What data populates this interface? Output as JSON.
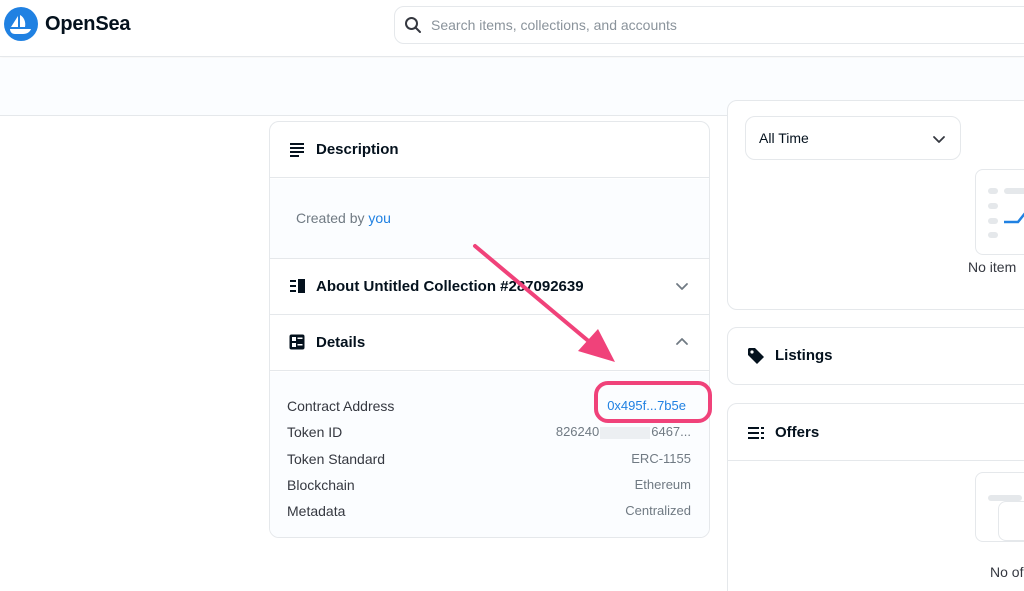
{
  "header": {
    "brand": "OpenSea",
    "search_placeholder": "Search items, collections, and accounts"
  },
  "description": {
    "title": "Description",
    "created_by_prefix": "Created by",
    "created_by_link": "you"
  },
  "about": {
    "title": "About Untitled Collection #287092639"
  },
  "details": {
    "title": "Details",
    "rows": [
      {
        "label": "Contract Address",
        "value": "0x495f...7b5e"
      },
      {
        "label": "Token ID",
        "value_start": "826240",
        "value_end": "6467..."
      },
      {
        "label": "Token Standard",
        "value": "ERC-1155"
      },
      {
        "label": "Blockchain",
        "value": "Ethereum"
      },
      {
        "label": "Metadata",
        "value": "Centralized"
      }
    ]
  },
  "price_history": {
    "time_filter": "All Time",
    "empty_text": "No item"
  },
  "listings": {
    "title": "Listings"
  },
  "offers": {
    "title": "Offers",
    "empty_text": "No of"
  },
  "colors": {
    "accent": "#2081e2",
    "highlight": "#f0427a"
  }
}
